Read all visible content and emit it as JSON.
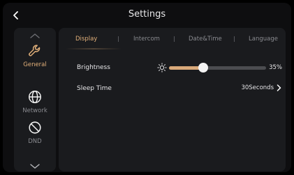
{
  "header": {
    "title": "Settings",
    "back_icon": "chevron-left-icon"
  },
  "sidebar": {
    "items": [
      {
        "label": "General",
        "icon": "wrench-icon",
        "active": true
      },
      {
        "label": "Network",
        "icon": "globe-icon",
        "active": false
      },
      {
        "label": "DND",
        "icon": "no-entry-icon",
        "active": false
      }
    ]
  },
  "tabs": [
    {
      "label": "Display",
      "active": true
    },
    {
      "label": "Intercom",
      "active": false
    },
    {
      "label": "Date&Time",
      "active": false
    },
    {
      "label": "Language",
      "active": false
    }
  ],
  "brightness": {
    "label": "Brightness",
    "value": 35,
    "value_text": "35%"
  },
  "sleep": {
    "label": "Sleep Time",
    "value": "30Seconds"
  },
  "colors": {
    "accent": "#e2b07a",
    "fill": "#d9a97a",
    "panel": "#1a1b1e",
    "background": "#0e0e10"
  }
}
